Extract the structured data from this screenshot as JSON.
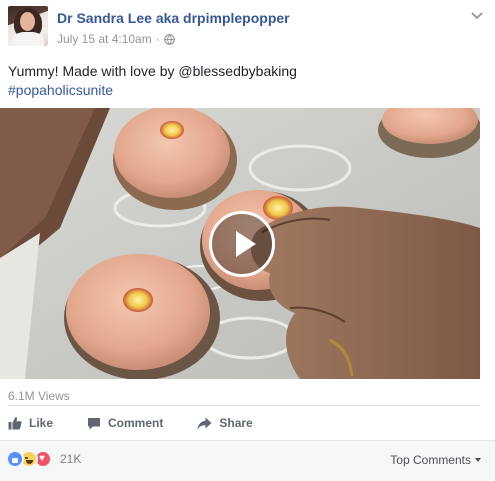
{
  "post": {
    "author": "Dr Sandra Lee aka drpimplepopper",
    "timestamp": "July 15 at 4:10am",
    "separator": "·",
    "privacy_icon": "globe-icon",
    "text_line": "Yummy! Made with love by @blessedbybaking",
    "hashtag": "#popaholicsunite"
  },
  "video": {
    "play_icon": "play-icon",
    "views": "6.1M Views"
  },
  "actions": {
    "like": "Like",
    "comment": "Comment",
    "share": "Share"
  },
  "reactions": {
    "icons": [
      "like-reaction-icon",
      "haha-reaction-icon",
      "love-reaction-icon"
    ],
    "count": "21K",
    "sort_label": "Top Comments"
  },
  "colors": {
    "link": "#365899",
    "meta": "#90949c",
    "action": "#606770",
    "footer_bg": "#f6f7f9"
  }
}
